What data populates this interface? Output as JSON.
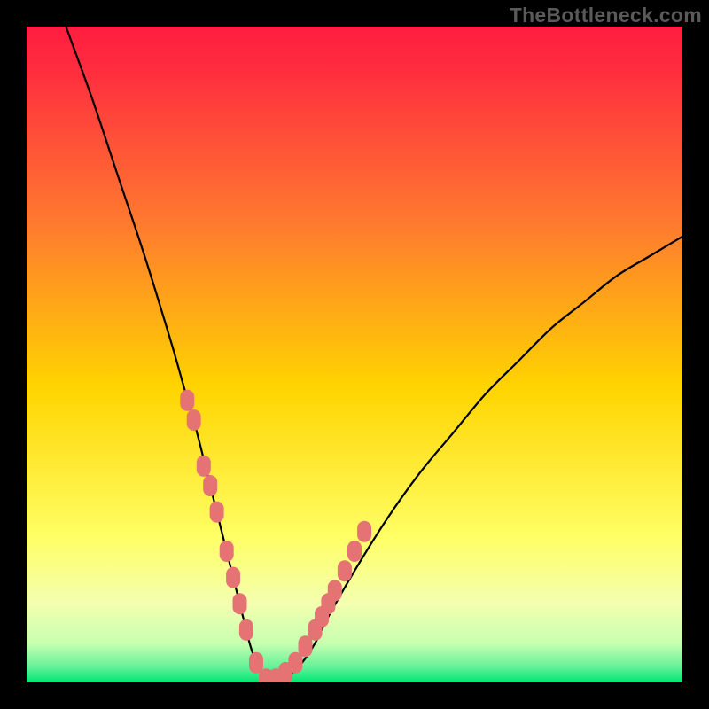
{
  "attribution": "TheBottleneck.com",
  "colors": {
    "frame": "#000000",
    "gradient_top": "#ff1d3f",
    "gradient_mid1": "#ff8a2a",
    "gradient_mid2": "#ffe600",
    "gradient_mid3": "#f7ff8a",
    "gradient_bottom": "#00e676",
    "curve": "#000000",
    "marker": "#e57373"
  },
  "chart_data": {
    "type": "line",
    "title": "",
    "xlabel": "",
    "ylabel": "",
    "xlim": [
      0,
      100
    ],
    "ylim": [
      0,
      100
    ],
    "series": [
      {
        "name": "bottleneck-curve",
        "x": [
          6,
          10,
          14,
          18,
          22,
          24,
          26,
          28,
          30,
          31,
          32,
          33,
          34,
          35,
          36,
          37,
          38,
          40,
          42,
          44,
          46,
          50,
          55,
          60,
          65,
          70,
          75,
          80,
          85,
          90,
          95,
          100
        ],
        "y": [
          100,
          89,
          77,
          65,
          52,
          45,
          38,
          30,
          22,
          18,
          14,
          10,
          6,
          3,
          1,
          0,
          0,
          1,
          3,
          6,
          10,
          17,
          25,
          32,
          38,
          44,
          49,
          54,
          58,
          62,
          65,
          68
        ]
      }
    ],
    "markers": {
      "name": "highlighted-points",
      "x": [
        24.5,
        25.5,
        27.0,
        28.0,
        29.0,
        30.5,
        31.5,
        32.5,
        33.5,
        35.0,
        36.5,
        38.0,
        39.5,
        41.0,
        42.5,
        44.0,
        45.0,
        46.0,
        47.0,
        48.5,
        50.0,
        51.5
      ],
      "y": [
        43,
        40,
        33,
        30,
        26,
        20,
        16,
        12,
        8,
        3,
        0.5,
        0.5,
        1.5,
        3,
        5.5,
        8,
        10,
        12,
        14,
        17,
        20,
        23
      ]
    },
    "gradient_stops": [
      {
        "offset": 0.0,
        "color": "#ff1d3f"
      },
      {
        "offset": 0.06,
        "color": "#ff2b3f"
      },
      {
        "offset": 0.3,
        "color": "#ff7a2f"
      },
      {
        "offset": 0.55,
        "color": "#ffd400"
      },
      {
        "offset": 0.78,
        "color": "#ffff66"
      },
      {
        "offset": 0.88,
        "color": "#f3ffb0"
      },
      {
        "offset": 0.94,
        "color": "#c8ffb0"
      },
      {
        "offset": 0.975,
        "color": "#6af29a"
      },
      {
        "offset": 1.0,
        "color": "#00e676"
      }
    ]
  }
}
